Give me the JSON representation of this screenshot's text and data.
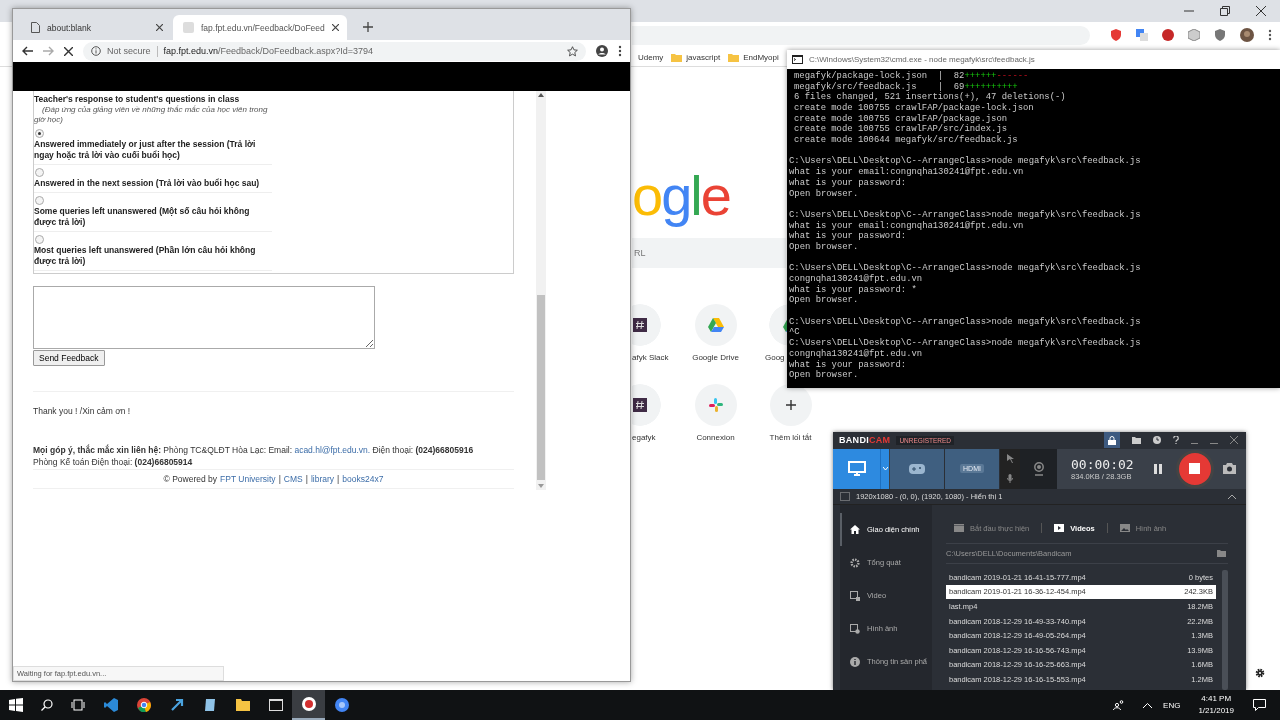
{
  "back_browser": {
    "bookmarks": [
      {
        "label": "Udemy",
        "kind": "plain"
      },
      {
        "label": "javascript",
        "kind": "folder"
      },
      {
        "label": "EndMyopi",
        "kind": "folder"
      }
    ],
    "logo": "ogle",
    "search": {
      "placeholder": "RL"
    },
    "shortcuts": [
      {
        "label": "afyk Slack",
        "kind": "slack"
      },
      {
        "label": "Google Drive",
        "kind": "drive"
      },
      {
        "label": "Goog",
        "kind": "drive"
      },
      {
        "label": "egafyk",
        "kind": "slack"
      },
      {
        "label": "Connexion",
        "kind": "pinwheel"
      },
      {
        "label": "Thêm lối tắt",
        "kind": "add"
      }
    ]
  },
  "browser": {
    "tabs": [
      {
        "title": "about:blank",
        "selected": false
      },
      {
        "title": "fap.fpt.edu.vn/Feedback/DoFeed",
        "selected": true
      }
    ],
    "security": "Not secure",
    "url_host": "fap.fpt.edu.vn",
    "url_path": "/Feedback/DoFeedback.aspx?Id=3794",
    "status": "Waiting for fap.fpt.edu.vn..."
  },
  "page": {
    "question": "Teacher's response to student's questions in class",
    "question_vi": "(Đáp ứng của giảng viên về những thắc mắc của học viên trong giờ học)",
    "options": [
      {
        "label": "Answered immediately or just after the session (Trả lời ngay hoặc trả lời vào cuối buổi học)",
        "selected": true
      },
      {
        "label": "Answered in the next session (Trả lời vào buổi học sau)",
        "selected": false
      },
      {
        "label": "Some queries left unanswered (Một số câu hỏi không được trả lời)",
        "selected": false
      },
      {
        "label": "Most queries left unanswered (Phần lớn câu hỏi không được trả lời)",
        "selected": false
      }
    ],
    "send_button": "Send Feedback",
    "thanks": "Thank you ! /Xin cảm ơn !",
    "contact": {
      "before": "**Mọi góp ý, thắc mắc xin liên hệ:** Phòng TC&QLĐT Hòa Lạc: Email:",
      "email": "acad.hl@fpt.edu.vn.",
      "after": "Điện thoại: **(024)66805916**"
    },
    "accounting": "Phòng Kế toán Điện thoại: **(024)66805914**",
    "footer": {
      "prefix": "© Powered by",
      "links": [
        {
          "label": "FPT University",
          "separator": "|"
        },
        {
          "label": "CMS",
          "separator": "|"
        },
        {
          "label": "library",
          "separator": "|"
        },
        {
          "label": "books24x7"
        }
      ]
    }
  },
  "terminal": {
    "title": "C:\\Windows\\System32\\cmd.exe - node  megafyk\\src\\feedback.js",
    "blocks": [
      {
        "indented": true,
        "lines": [
          {
            "text": "megafyk/package-lock.json  |  82",
            "plus": "++++++",
            "minus": "------"
          },
          {
            "text": "megafyk/src/feedback.js    |  69",
            "plus": "++++++++++"
          },
          {
            "text": "6 files changed, 521 insertions(+), 47 deletions(-)"
          },
          {
            "text": "create mode 100755 crawlFAP/package-lock.json"
          },
          {
            "text": "create mode 100755 crawlFAP/package.json"
          },
          {
            "text": "create mode 100755 crawlFAP/src/index.js"
          },
          {
            "text": "create mode 100644 megafyk/src/feedback.js"
          }
        ]
      },
      {
        "lines": [
          {
            "text": "C:\\Users\\DELL\\Desktop\\C--ArrangeClass>node megafyk\\src\\feedback.js"
          },
          {
            "text": "what is your email:congnqha130241@fpt.edu.vn"
          },
          {
            "text": "what is your password:"
          },
          {
            "text": "Open browser."
          }
        ]
      },
      {
        "lines": [
          {
            "text": "C:\\Users\\DELL\\Desktop\\C--ArrangeClass>node megafyk\\src\\feedback.js"
          },
          {
            "text": "what is your email:congnqha130241@fpt.edu.vn"
          },
          {
            "text": "what is your password:"
          },
          {
            "text": "Open browser."
          }
        ]
      },
      {
        "lines": [
          {
            "text": "C:\\Users\\DELL\\Desktop\\C--ArrangeClass>node megafyk\\src\\feedback.js"
          },
          {
            "text": "congnqha130241@fpt.edu.vn"
          },
          {
            "text": "what is your password: *"
          },
          {
            "text": "Open browser."
          }
        ]
      },
      {
        "lines": [
          {
            "text": "C:\\Users\\DELL\\Desktop\\C--ArrangeClass>node megafyk\\src\\feedback.js"
          },
          {
            "text": "^C"
          },
          {
            "text": "C:\\Users\\DELL\\Desktop\\C--ArrangeClass>node megafyk\\src\\feedback.js"
          },
          {
            "text": "congnqha130241@fpt.edu.vn"
          },
          {
            "text": "what is your password:"
          },
          {
            "text": "Open browser."
          }
        ]
      }
    ]
  },
  "recorder": {
    "brand": "BANDI",
    "brand_accent": "CAM",
    "badge": "UNREGISTERED",
    "hdmi_label": "HDMI",
    "timer": "00:00:02",
    "size": "834.0KB / 28.3GB",
    "target": "1920x1080 - (0, 0), (1920, 1080) - Hiển thị 1",
    "menu": [
      {
        "label": "Giao diện chính",
        "kind": "home",
        "selected": true
      },
      {
        "label": "Tổng quát",
        "kind": "gear",
        "selected": false
      },
      {
        "label": "Video",
        "kind": "video",
        "selected": false
      },
      {
        "label": "Hình ảnh",
        "kind": "image",
        "selected": false
      },
      {
        "label": "Thông tin sản phẩ",
        "kind": "info",
        "selected": false
      }
    ],
    "tabs": [
      {
        "label": "Bắt đầu thực hiện",
        "kind": "clapper",
        "selected": false
      },
      {
        "label": "Videos",
        "kind": "play",
        "selected": true
      },
      {
        "label": "Hình ảnh",
        "kind": "image",
        "selected": false
      }
    ],
    "path": "C:\\Users\\DELL\\Documents\\Bandicam",
    "files": [
      {
        "name": "bandicam 2019-01-21 16-41-15-777.mp4",
        "size": "0 bytes",
        "selected": false
      },
      {
        "name": "bandicam 2019-01-21 16-36-12-454.mp4",
        "size": "242.3KB",
        "selected": true
      },
      {
        "name": "last.mp4",
        "size": "18.2MB",
        "selected": false
      },
      {
        "name": "bandicam 2018-12-29 16-49-33-740.mp4",
        "size": "22.2MB",
        "selected": false
      },
      {
        "name": "bandicam 2018-12-29 16-49-05-264.mp4",
        "size": "1.3MB",
        "selected": false
      },
      {
        "name": "bandicam 2018-12-29 16-16-56-743.mp4",
        "size": "13.9MB",
        "selected": false
      },
      {
        "name": "bandicam 2018-12-29 16-16-25-663.mp4",
        "size": "1.6MB",
        "selected": false
      },
      {
        "name": "bandicam 2018-12-29 16-16-15-553.mp4",
        "size": "1.2MB",
        "selected": false
      }
    ]
  },
  "taskbar": {
    "apps": [
      {
        "kind": "ribbon",
        "active": false
      },
      {
        "kind": "browser",
        "active": false
      },
      {
        "kind": "arrow",
        "active": false
      },
      {
        "kind": "tablet",
        "active": false
      },
      {
        "kind": "folder",
        "active": false
      },
      {
        "kind": "terminal",
        "active": false
      },
      {
        "kind": "record",
        "active": true
      },
      {
        "kind": "globe",
        "active": false
      }
    ],
    "language": "ENG",
    "time": "4:41 PM",
    "date": "1/21/2019"
  }
}
